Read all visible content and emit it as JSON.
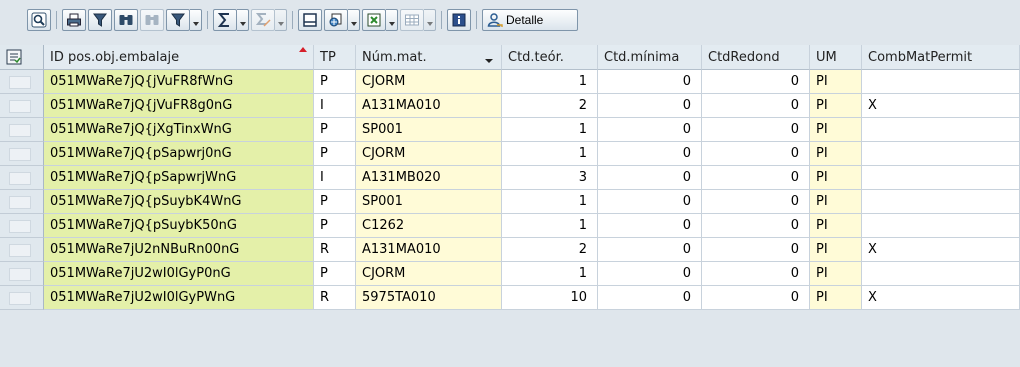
{
  "toolbar": {
    "buttons": [
      {
        "name": "select-details-icon",
        "enabled": true
      },
      {
        "name": "print-icon",
        "enabled": true
      },
      {
        "name": "filter-icon",
        "enabled": true
      },
      {
        "name": "find-icon",
        "enabled": true
      },
      {
        "name": "find-next-icon",
        "enabled": false
      },
      {
        "name": "set-filter-icon",
        "enabled": true
      },
      {
        "name": "sum-icon",
        "enabled": true
      },
      {
        "name": "subtotal-icon",
        "enabled": false
      },
      {
        "name": "print-preview-icon",
        "enabled": true
      },
      {
        "name": "views-icon",
        "enabled": true
      },
      {
        "name": "export-icon",
        "enabled": true
      },
      {
        "name": "layout-icon",
        "enabled": false
      },
      {
        "name": "information-icon",
        "enabled": true
      }
    ],
    "detalle_label": "Detalle"
  },
  "columns": {
    "id": "ID pos.obj.embalaje",
    "tp": "TP",
    "mat": "Núm.mat.",
    "teor": "Ctd.teór.",
    "min": "Ctd.mínima",
    "redond": "CtdRedond",
    "um": "UM",
    "comb": "CombMatPermit"
  },
  "rows": [
    {
      "id": "051MWaRe7jQ{jVuFR8fWnG",
      "tp": "P",
      "mat": "CJORM",
      "teor": "1",
      "min": "0",
      "redond": "0",
      "um": "PI",
      "comb": ""
    },
    {
      "id": "051MWaRe7jQ{jVuFR8g0nG",
      "tp": "I",
      "mat": "A131MA010",
      "teor": "2",
      "min": "0",
      "redond": "0",
      "um": "PI",
      "comb": "X"
    },
    {
      "id": "051MWaRe7jQ{jXgTinxWnG",
      "tp": "P",
      "mat": "SP001",
      "teor": "1",
      "min": "0",
      "redond": "0",
      "um": "PI",
      "comb": ""
    },
    {
      "id": "051MWaRe7jQ{pSapwrj0nG",
      "tp": "P",
      "mat": "CJORM",
      "teor": "1",
      "min": "0",
      "redond": "0",
      "um": "PI",
      "comb": ""
    },
    {
      "id": "051MWaRe7jQ{pSapwrjWnG",
      "tp": "I",
      "mat": "A131MB020",
      "teor": "3",
      "min": "0",
      "redond": "0",
      "um": "PI",
      "comb": ""
    },
    {
      "id": "051MWaRe7jQ{pSuybK4WnG",
      "tp": "P",
      "mat": "SP001",
      "teor": "1",
      "min": "0",
      "redond": "0",
      "um": "PI",
      "comb": ""
    },
    {
      "id": "051MWaRe7jQ{pSuybK50nG",
      "tp": "P",
      "mat": "C1262",
      "teor": "1",
      "min": "0",
      "redond": "0",
      "um": "PI",
      "comb": ""
    },
    {
      "id": "051MWaRe7jU2nNBuRn00nG",
      "tp": "R",
      "mat": "A131MA010",
      "teor": "2",
      "min": "0",
      "redond": "0",
      "um": "PI",
      "comb": "X"
    },
    {
      "id": "051MWaRe7jU2wI0lGyP0nG",
      "tp": "P",
      "mat": "CJORM",
      "teor": "1",
      "min": "0",
      "redond": "0",
      "um": "PI",
      "comb": ""
    },
    {
      "id": "051MWaRe7jU2wI0lGyPWnG",
      "tp": "R",
      "mat": "5975TA010",
      "teor": "10",
      "min": "0",
      "redond": "0",
      "um": "PI",
      "comb": "X"
    }
  ],
  "colors": {
    "key_column": "#e4f0a9",
    "input_column": "#fffbd7",
    "sort_indicator": "#d61f2a"
  }
}
